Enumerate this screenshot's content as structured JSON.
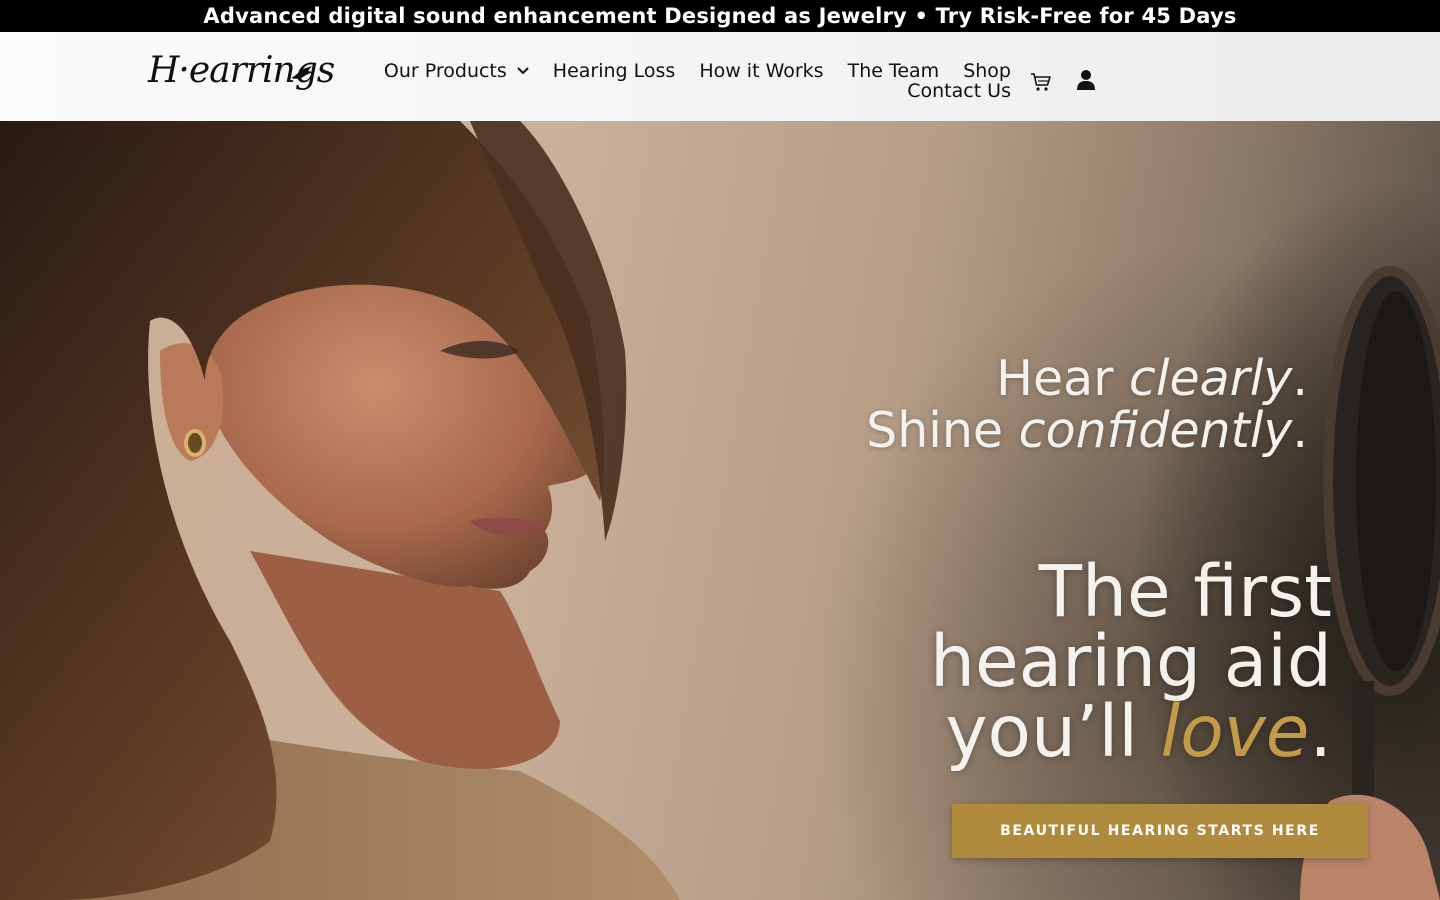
{
  "announcement": {
    "text": "Advanced digital sound enhancement Designed as Jewelry • Try Risk-Free for 45 Days"
  },
  "header": {
    "logo_text": "H·earrings",
    "nav": {
      "our_products": "Our Products",
      "hearing_loss": "Hearing Loss",
      "how_it_works": "How it Works",
      "the_team": "The Team",
      "shop": "Shop",
      "contact_us": "Contact Us"
    },
    "icons": [
      "cart-icon",
      "user-icon",
      "chevron-down-icon"
    ]
  },
  "hero": {
    "tagline_line1_pre": "Hear ",
    "tagline_line1_em": "clearly",
    "tagline_line1_post": ".",
    "tagline_line2_pre": "Shine ",
    "tagline_line2_em": "confidently",
    "tagline_line2_post": ".",
    "headline_line1": "The first",
    "headline_line2": "hearing aid",
    "headline_line3_pre": "you’ll ",
    "headline_line3_gold": "love",
    "headline_line3_post": ".",
    "cta_label": "BEAUTIFUL HEARING STARTS HERE"
  },
  "colors": {
    "announcement_bg": "#000000",
    "accent_gold": "#b08a3d",
    "headline_gold": "#c29a48"
  }
}
